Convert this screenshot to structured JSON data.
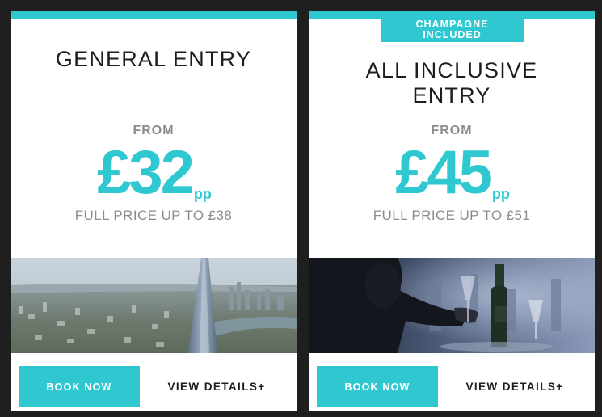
{
  "cards": [
    {
      "title": "GENERAL ENTRY",
      "from_label": "FROM",
      "price": "£32",
      "price_unit": "pp",
      "full_price": "FULL PRICE UP TO £38",
      "image_alt": "aerial-view-of-london-with-the-shard",
      "book_label": "BOOK NOW",
      "details_label": "VIEW DETAILS+"
    },
    {
      "badge": "CHAMPAGNE INCLUDED",
      "title_line1": "ALL INCLUSIVE",
      "title_line2": "ENTRY",
      "from_label": "FROM",
      "price": "£45",
      "price_unit": "pp",
      "full_price": "FULL PRICE UP TO £51",
      "image_alt": "woman-holding-champagne-glass",
      "book_label": "BOOK NOW",
      "details_label": "VIEW DETAILS+"
    }
  ],
  "colors": {
    "accent": "#2fc8d0",
    "background": "#1f1f1f",
    "card": "#ffffff",
    "text_dark": "#1d1d1d",
    "text_muted": "#8c8c8c"
  }
}
